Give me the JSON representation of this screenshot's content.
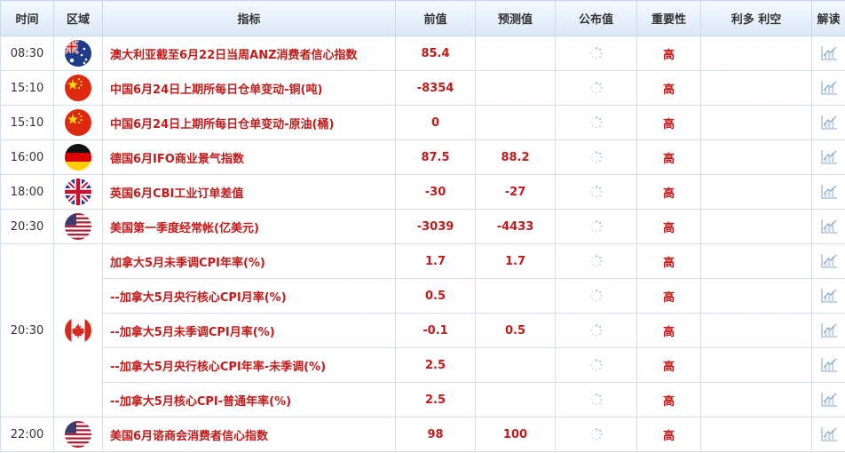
{
  "header": {
    "time": "时间",
    "region": "区域",
    "indicator": "指标",
    "previous": "前值",
    "forecast": "预测值",
    "actual": "公布值",
    "importance": "重要性",
    "impact": "利多 利空",
    "analysis": "解读"
  },
  "rows": [
    {
      "time": "08:30",
      "flag": "australia-flag",
      "name": "澳大利亚截至6月22日当周ANZ消费者信心指数",
      "prev": "85.4",
      "fc": "",
      "imp": "高"
    },
    {
      "time": "15:10",
      "flag": "china-flag",
      "name": "中国6月24日上期所每日仓单变动-铜(吨)",
      "prev": "-8354",
      "fc": "",
      "imp": "高"
    },
    {
      "time": "15:10",
      "flag": "china-flag",
      "name": "中国6月24日上期所每日仓单变动-原油(桶)",
      "prev": "0",
      "fc": "",
      "imp": "高"
    },
    {
      "time": "16:00",
      "flag": "germany-flag",
      "name": "德国6月IFO商业景气指数",
      "prev": "87.5",
      "fc": "88.2",
      "imp": "高"
    },
    {
      "time": "18:00",
      "flag": "uk-flag",
      "name": "英国6月CBI工业订单差值",
      "prev": "-30",
      "fc": "-27",
      "imp": "高"
    },
    {
      "time": "20:30",
      "flag": "usa-flag",
      "name": "美国第一季度经常帐(亿美元)",
      "prev": "-3039",
      "fc": "-4433",
      "imp": "高"
    },
    {
      "time": "20:30",
      "flag": "canada-flag",
      "name": "加拿大5月未季调CPI年率(%)",
      "prev": "1.7",
      "fc": "1.7",
      "imp": "高"
    },
    {
      "time": "",
      "flag": "",
      "name": "--加拿大5月央行核心CPI月率(%)",
      "prev": "0.5",
      "fc": "",
      "imp": "高"
    },
    {
      "time": "",
      "flag": "",
      "name": "--加拿大5月未季调CPI月率(%)",
      "prev": "-0.1",
      "fc": "0.5",
      "imp": "高"
    },
    {
      "time": "",
      "flag": "",
      "name": "--加拿大5月央行核心CPI年率-未季调(%)",
      "prev": "2.5",
      "fc": "",
      "imp": "高"
    },
    {
      "time": "",
      "flag": "",
      "name": "--加拿大5月核心CPI-普通年率(%)",
      "prev": "2.5",
      "fc": "",
      "imp": "高"
    },
    {
      "time": "22:00",
      "flag": "usa-flag",
      "name": "美国6月谘商会消费者信心指数",
      "prev": "98",
      "fc": "100",
      "imp": "高"
    }
  ],
  "colors": {
    "value_red": "#c41a1a",
    "header_bg": "#dbe8f7",
    "border": "#d3dfee"
  }
}
